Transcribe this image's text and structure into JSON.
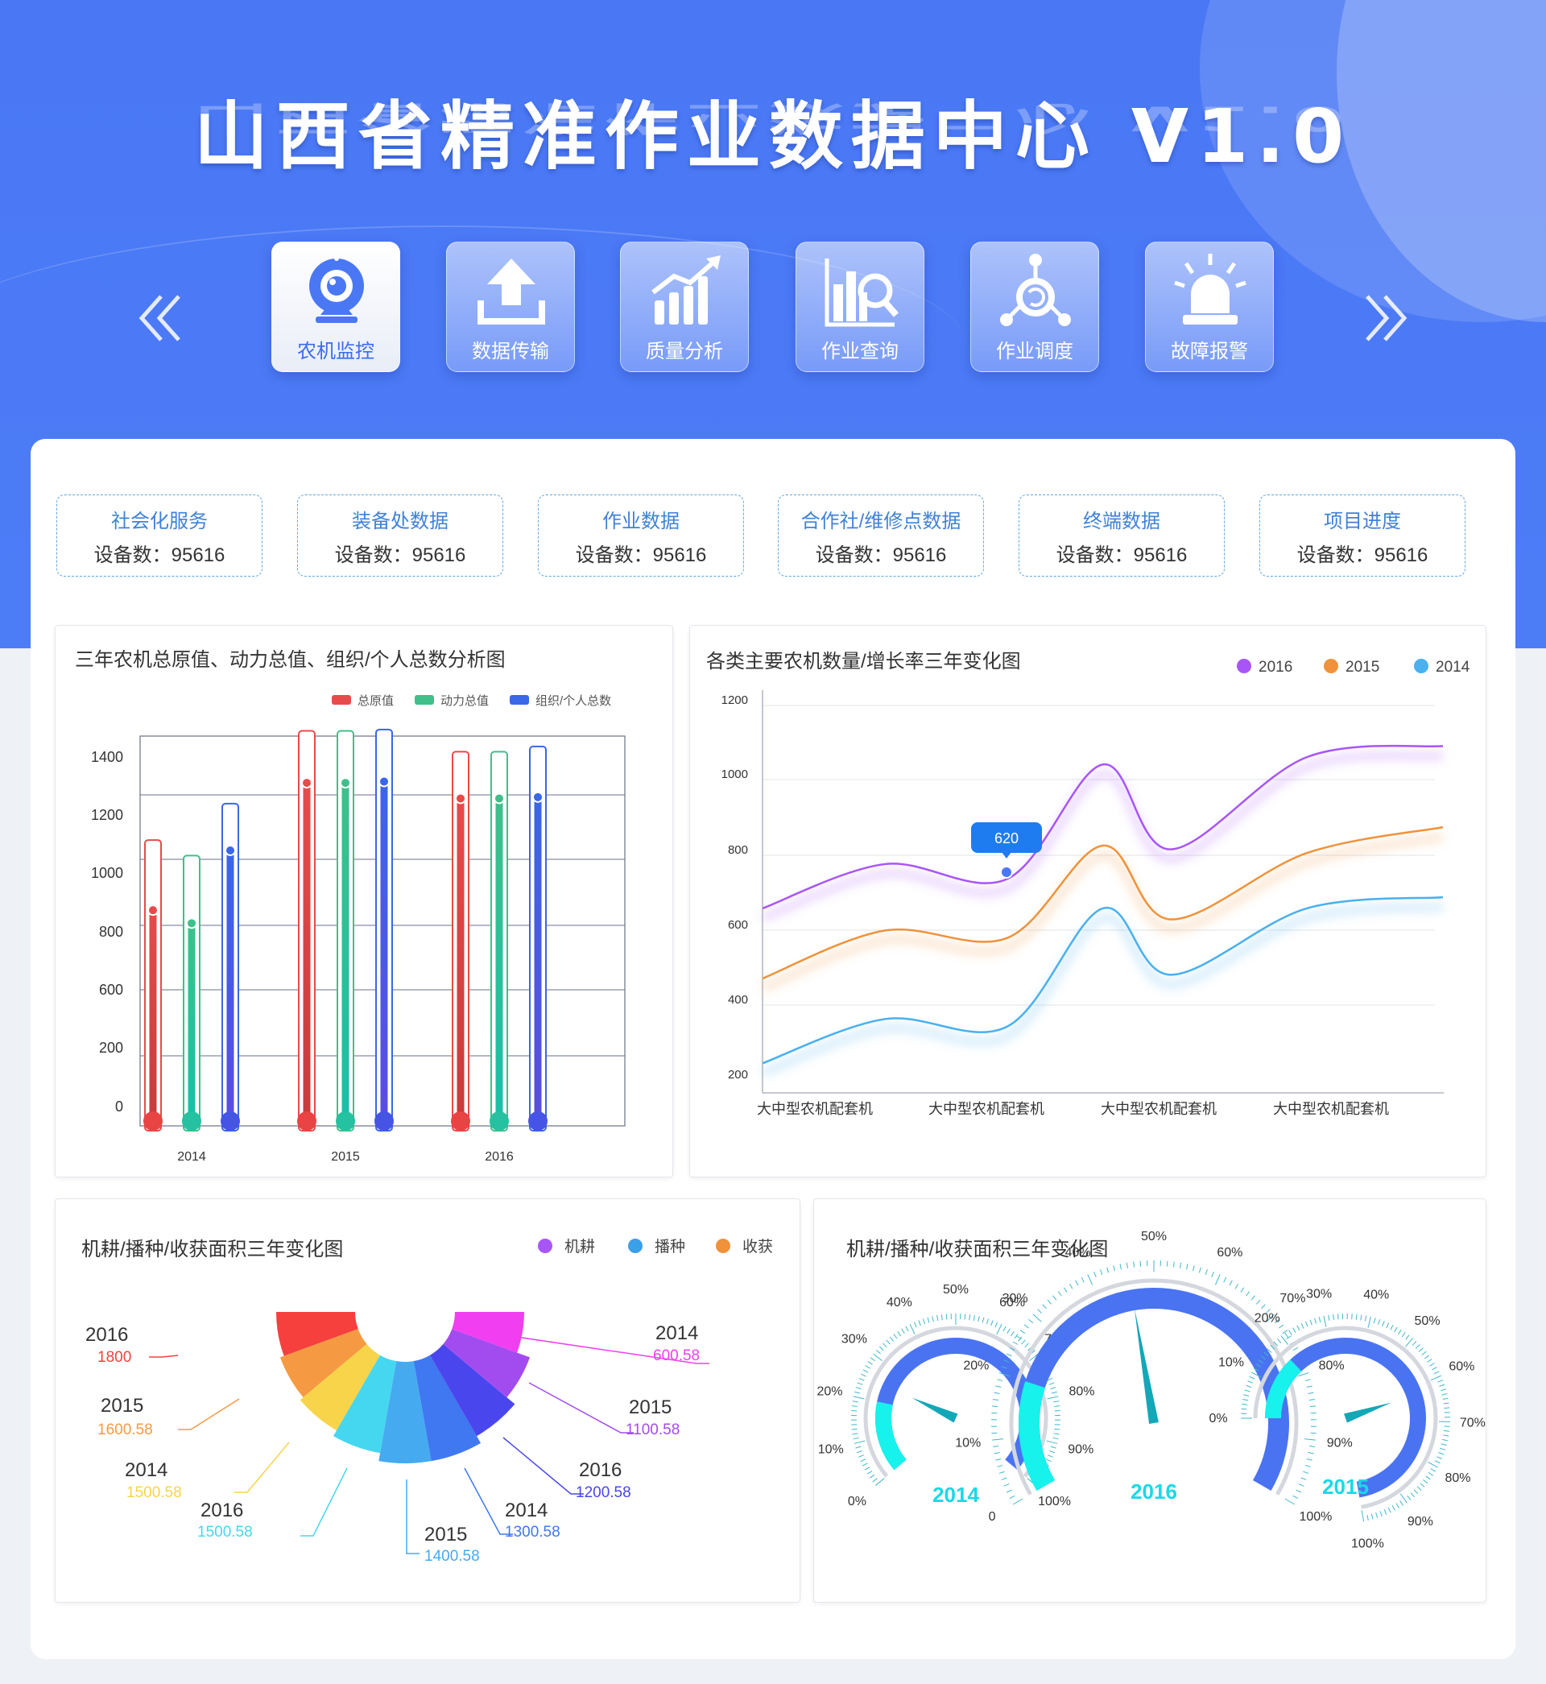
{
  "header": {
    "title": "山西省精准作业数据中心 V1.0"
  },
  "nav": {
    "items": [
      {
        "label": "农机监控",
        "icon": "webcam-icon",
        "active": true
      },
      {
        "label": "数据传输",
        "icon": "upload-icon"
      },
      {
        "label": "质量分析",
        "icon": "bar-growth-icon"
      },
      {
        "label": "作业查询",
        "icon": "chart-search-icon"
      },
      {
        "label": "作业调度",
        "icon": "dispatch-network-icon"
      },
      {
        "label": "故障报警",
        "icon": "alarm-light-icon"
      }
    ]
  },
  "stats": [
    {
      "title": "社会化服务",
      "value": "设备数：95616"
    },
    {
      "title": "装备处数据",
      "value": "设备数：95616"
    },
    {
      "title": "作业数据",
      "value": "设备数：95616"
    },
    {
      "title": "合作社/维修点数据",
      "value": "设备数：95616"
    },
    {
      "title": "终端数据",
      "value": "设备数：95616"
    },
    {
      "title": "项目进度",
      "value": "设备数：95616"
    }
  ],
  "chart_data": [
    {
      "type": "bar",
      "title": "三年农机总原值、动力总值、组织/个人总数分析图",
      "categories": [
        "2014",
        "2015",
        "2016"
      ],
      "yticks": [
        "1400",
        "1200",
        "1000",
        "800",
        "600",
        "200",
        "0"
      ],
      "series": [
        {
          "name": "总原值",
          "color": "#e84a4a",
          "values": [
            830,
            1320,
            1260
          ],
          "max": [
            1100,
            1520,
            1440
          ]
        },
        {
          "name": "动力总值",
          "color": "#3fc08a",
          "values": [
            780,
            1320,
            1260
          ],
          "max": [
            1040,
            1520,
            1440
          ]
        },
        {
          "name": "组织/个人总数",
          "color": "#3a66e8",
          "values": [
            1060,
            1325,
            1265
          ],
          "max": [
            1240,
            1525,
            1460
          ]
        }
      ],
      "legend": "top-right"
    },
    {
      "type": "line",
      "title": "各类主要农机数量/增长率三年变化图",
      "categories": [
        "大中型农机配套机",
        "大中型农机配套机",
        "大中型农机配套机",
        "大中型农机配套机"
      ],
      "yticks": [
        "1200",
        "1000",
        "800",
        "600",
        "400",
        "200"
      ],
      "ylim": [
        200,
        1200
      ],
      "series": [
        {
          "name": "2016",
          "color": "#a855f7",
          "x": [
            0,
            0.18,
            0.36,
            0.5,
            0.6,
            0.8,
            1.0
          ],
          "y": [
            650,
            770,
            730,
            1040,
            810,
            1060,
            1090
          ]
        },
        {
          "name": "2015",
          "color": "#f0923a",
          "x": [
            0,
            0.18,
            0.36,
            0.5,
            0.6,
            0.8,
            1.0
          ],
          "y": [
            460,
            590,
            570,
            820,
            620,
            800,
            870
          ]
        },
        {
          "name": "2014",
          "color": "#4ab0ee",
          "x": [
            0,
            0.18,
            0.36,
            0.5,
            0.6,
            0.8,
            1.0
          ],
          "y": [
            230,
            350,
            330,
            650,
            470,
            650,
            680
          ]
        }
      ],
      "tooltip": {
        "label": "620"
      },
      "legend": "top-right"
    },
    {
      "type": "pie",
      "title": "机耕/播种/收获面积三年变化图",
      "legend": [
        {
          "name": "机耕",
          "color": "#a855f7"
        },
        {
          "name": "播种",
          "color": "#3aa0e8"
        },
        {
          "name": "收获",
          "color": "#f0923a"
        }
      ],
      "slices": [
        {
          "year": "2016",
          "value": "1800",
          "color": "#f5403e"
        },
        {
          "year": "2015",
          "value": "1600.58",
          "color": "#f59a42"
        },
        {
          "year": "2014",
          "value": "1500.58",
          "color": "#f7d44a"
        },
        {
          "year": "2016",
          "value": "1500.58",
          "color": "#45d7f0"
        },
        {
          "year": "2015",
          "value": "1400.58",
          "color": "#45aaf0"
        },
        {
          "year": "2014",
          "value": "1300.58",
          "color": "#3f78f0"
        },
        {
          "year": "2016",
          "value": "1200.58",
          "color": "#4a46ee"
        },
        {
          "year": "2015",
          "value": "1100.58",
          "color": "#a24cf0"
        },
        {
          "year": "2014",
          "value": "600.58",
          "color": "#f03ef0"
        }
      ]
    },
    {
      "type": "gauge",
      "title": "机耕/播种/收获面积三年变化图",
      "gauges": [
        {
          "label": "2014",
          "ticks": [
            "0%",
            "10%",
            "20%",
            "30%",
            "40%",
            "50%",
            "60%",
            "70%",
            "80%",
            "90%",
            "100%"
          ],
          "value": 0.25
        },
        {
          "label": "2016",
          "ticks": [
            "0",
            "10%",
            "20%",
            "30%",
            "40%",
            "50%",
            "60%",
            "70%",
            "80%",
            "90%",
            "100%"
          ],
          "value": 0.46
        },
        {
          "label": "2015",
          "ticks": [
            "0%",
            "10%",
            "20%",
            "30%",
            "40%",
            "50%",
            "60%",
            "70%",
            "80%",
            "90%",
            "100%"
          ],
          "value": 0.62
        }
      ]
    }
  ]
}
